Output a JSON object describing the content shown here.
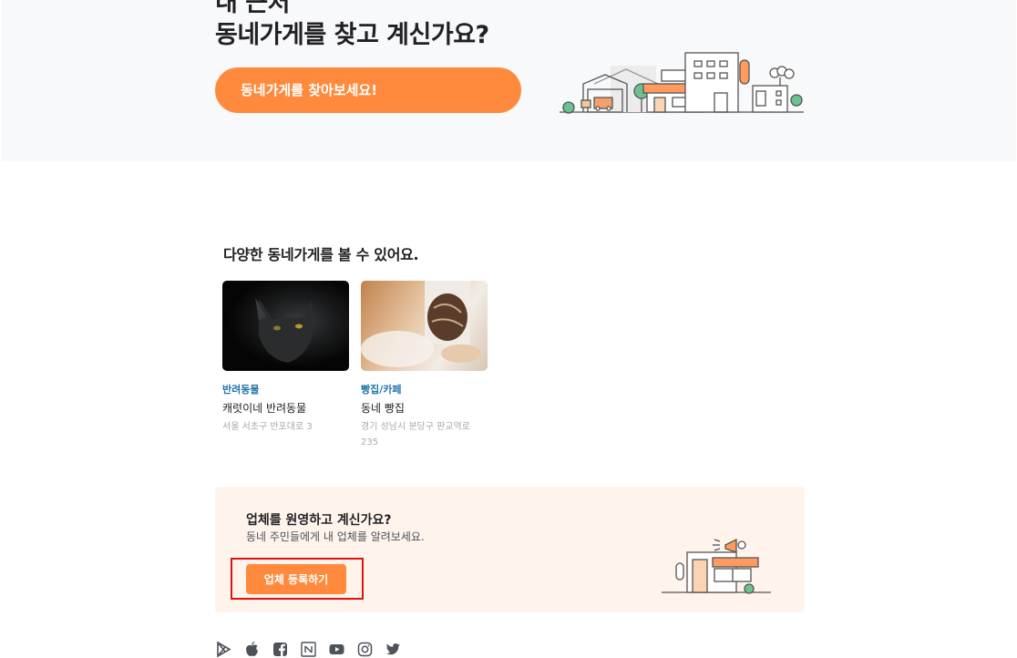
{
  "hero": {
    "title_line1": "내 근처",
    "title_line2": "동네가게를 찾고 계신가요?",
    "button_label": "동네가게를 찾아보세요!"
  },
  "section": {
    "title": "다양한 동네가게를 볼 수 있어요."
  },
  "cards": [
    {
      "category": "반려동물",
      "name": "캐럿이네 반려동물",
      "address": "서울 서초구 반포대로 3",
      "image": "black-cat-photo"
    },
    {
      "category": "빵집/카페",
      "name": "동네 빵집",
      "address": "경기 성남시 분당구 판교역로 235",
      "image": "baker-bread-photo"
    }
  ],
  "banner": {
    "title": "업체를 원영하고 계신가요?",
    "description": "동네 주민들에게 내 업체를 알려보세요.",
    "button_label": "업체 등록하기"
  },
  "social": [
    "google-play-icon",
    "apple-icon",
    "facebook-icon",
    "naver-icon",
    "youtube-icon",
    "instagram-icon",
    "twitter-icon"
  ],
  "colors": {
    "accent": "#ff8a3d",
    "category": "#1e74a5",
    "banner_bg": "#fff4ec",
    "hero_bg": "#f8f9fa"
  }
}
